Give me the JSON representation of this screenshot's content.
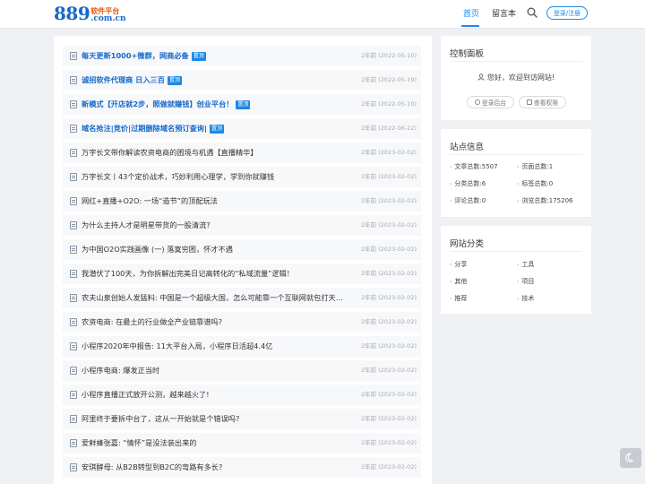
{
  "header": {
    "logo_number": "889",
    "logo_cn": "软件平台",
    "logo_domain": ".com.cn",
    "nav": {
      "home": "首页",
      "guestbook": "留言本"
    },
    "login_label": "登录/注册"
  },
  "articles": [
    {
      "title": "每天更新1000+微群，网商必备",
      "tag": "置顶",
      "date": "2年前 (2022-05-10)",
      "pinned": true
    },
    {
      "title": "诚招软件代理商 日入三百",
      "tag": "置顶",
      "date": "2年前 (2022-05-19)",
      "pinned": true
    },
    {
      "title": "新模式【开店就2步，照做就赚钱】创业平台！",
      "tag": "置顶",
      "date": "2年前 (2022-05-10)",
      "pinned": true
    },
    {
      "title": "域名抢注|竞价|过期删除域名预订查询|",
      "tag": "置顶",
      "date": "2年前 (2022-06-22)",
      "pinned": true
    },
    {
      "title": "万字长文带你解读农资电商的困境与机遇【直播精华】",
      "tag": "",
      "date": "2年前 (2023-02-02)",
      "pinned": false
    },
    {
      "title": "万字长文丨43个定价战术，巧妙利用心理学，学到你就赚钱",
      "tag": "",
      "date": "2年前 (2023-02-02)",
      "pinned": false
    },
    {
      "title": "网红+直播+O2O: 一场“造节”的顶配玩法",
      "tag": "",
      "date": "2年前 (2023-02-02)",
      "pinned": false
    },
    {
      "title": "为什么主持人才是明星带货的一股清流?",
      "tag": "",
      "date": "2年前 (2023-02-02)",
      "pinned": false
    },
    {
      "title": "为中国O2O实践画像 (一) 落寞穷困，怀才不遇",
      "tag": "",
      "date": "2年前 (2023-02-02)",
      "pinned": false
    },
    {
      "title": "我潜伏了100天，为你拆解出完美日记高转化的“私域流量”逻辑！",
      "tag": "",
      "date": "2年前 (2023-02-02)",
      "pinned": false
    },
    {
      "title": "农夫山泉创始人发猛料: 中国是一个超级大国，怎么可能靠一个互联网就包打天…",
      "tag": "",
      "date": "2年前 (2023-02-02)",
      "pinned": false
    },
    {
      "title": "农资电商: 在最土的行业做全产业链靠谱吗?",
      "tag": "",
      "date": "2年前 (2023-02-02)",
      "pinned": false
    },
    {
      "title": "小程序2020年中报告: 11大平台入局，小程序日活超4.4亿",
      "tag": "",
      "date": "2年前 (2023-02-02)",
      "pinned": false
    },
    {
      "title": "小程序电商: 爆发正当时",
      "tag": "",
      "date": "2年前 (2023-02-02)",
      "pinned": false
    },
    {
      "title": "小程序直播正式放开公测，越来越火了!",
      "tag": "",
      "date": "2年前 (2023-02-02)",
      "pinned": false
    },
    {
      "title": "阿里终于要拆中台了，这从一开始就是个错误吗?",
      "tag": "",
      "date": "2年前 (2023-02-02)",
      "pinned": false
    },
    {
      "title": "爱鲜蜂张嘉: “情怀”是没法装出来的",
      "tag": "",
      "date": "2年前 (2023-02-02)",
      "pinned": false
    },
    {
      "title": "安琪酵母: 从B2B转型到B2C的弯路有多长?",
      "tag": "",
      "date": "2年前 (2023-02-02)",
      "pinned": false
    }
  ],
  "control_panel": {
    "title": "控制面板",
    "welcome": "您好，欢迎到访网站!",
    "login_backend": "登录后台",
    "view_permission": "查看权限"
  },
  "site_info": {
    "title": "站点信息",
    "stats": [
      "文章总数:5507",
      "页面总数:1",
      "分类总数:6",
      "标签总数:0",
      "评论总数:0",
      "浏览总数:175206"
    ]
  },
  "categories": {
    "title": "网站分类",
    "items": [
      "分享",
      "工具",
      "其他",
      "项目",
      "推荐",
      "技术"
    ]
  },
  "colors": {
    "accent": "#1e88e5",
    "pinned_title": "#1769c9",
    "logo_orange": "#e8590c"
  }
}
